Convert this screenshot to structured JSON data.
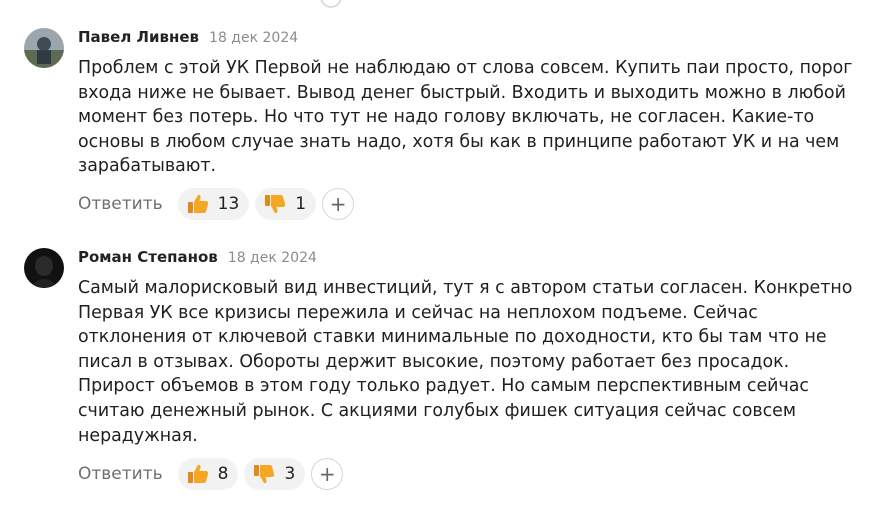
{
  "comments": [
    {
      "author": "Павел Ливнев",
      "date": "18 дек 2024",
      "text": "Проблем с этой УК Первой не наблюдаю от слова совсем. Купить паи просто, порог\nвхода ниже не бывает. Вывод денег быстрый. Входить и выходить можно в любой\nмомент без потерь. Но что тут не надо голову включать, не согласен. Какие-то\nосновы в любом случае знать надо, хотя бы как в принципе работают УК и на чем\nзарабатывают.",
      "reply_label": "Ответить",
      "likes": "13",
      "dislikes": "1",
      "add_reaction": "+",
      "like_icon": "thumbs-up-icon",
      "dislike_icon": "thumbs-down-icon"
    },
    {
      "author": "Роман Степанов",
      "date": "18 дек 2024",
      "text": "Самый малорисковый вид инвестиций, тут я с автором статьи согласен. Конкретно\nПервая УК все кризисы пережила и сейчас на неплохом подъеме. Сейчас\nотклонения от ключевой ставки минимальные по доходности, кто бы там что не\nписал в отзывах. Обороты держит высокие, поэтому работает без просадок.\nПрирост объемов в этом году только радует. Но самым перспективным сейчас\nсчитаю денежный рынок. С акциями голубых фишек ситуация сейчас совсем\nнерадужная.",
      "reply_label": "Ответить",
      "likes": "8",
      "dislikes": "3",
      "add_reaction": "+",
      "like_icon": "thumbs-up-icon",
      "dislike_icon": "thumbs-down-icon"
    }
  ],
  "colors": {
    "reaction_emoji": "#f5a623",
    "pill_bg": "#f2f2f2",
    "muted_text": "#8c8c8c"
  }
}
